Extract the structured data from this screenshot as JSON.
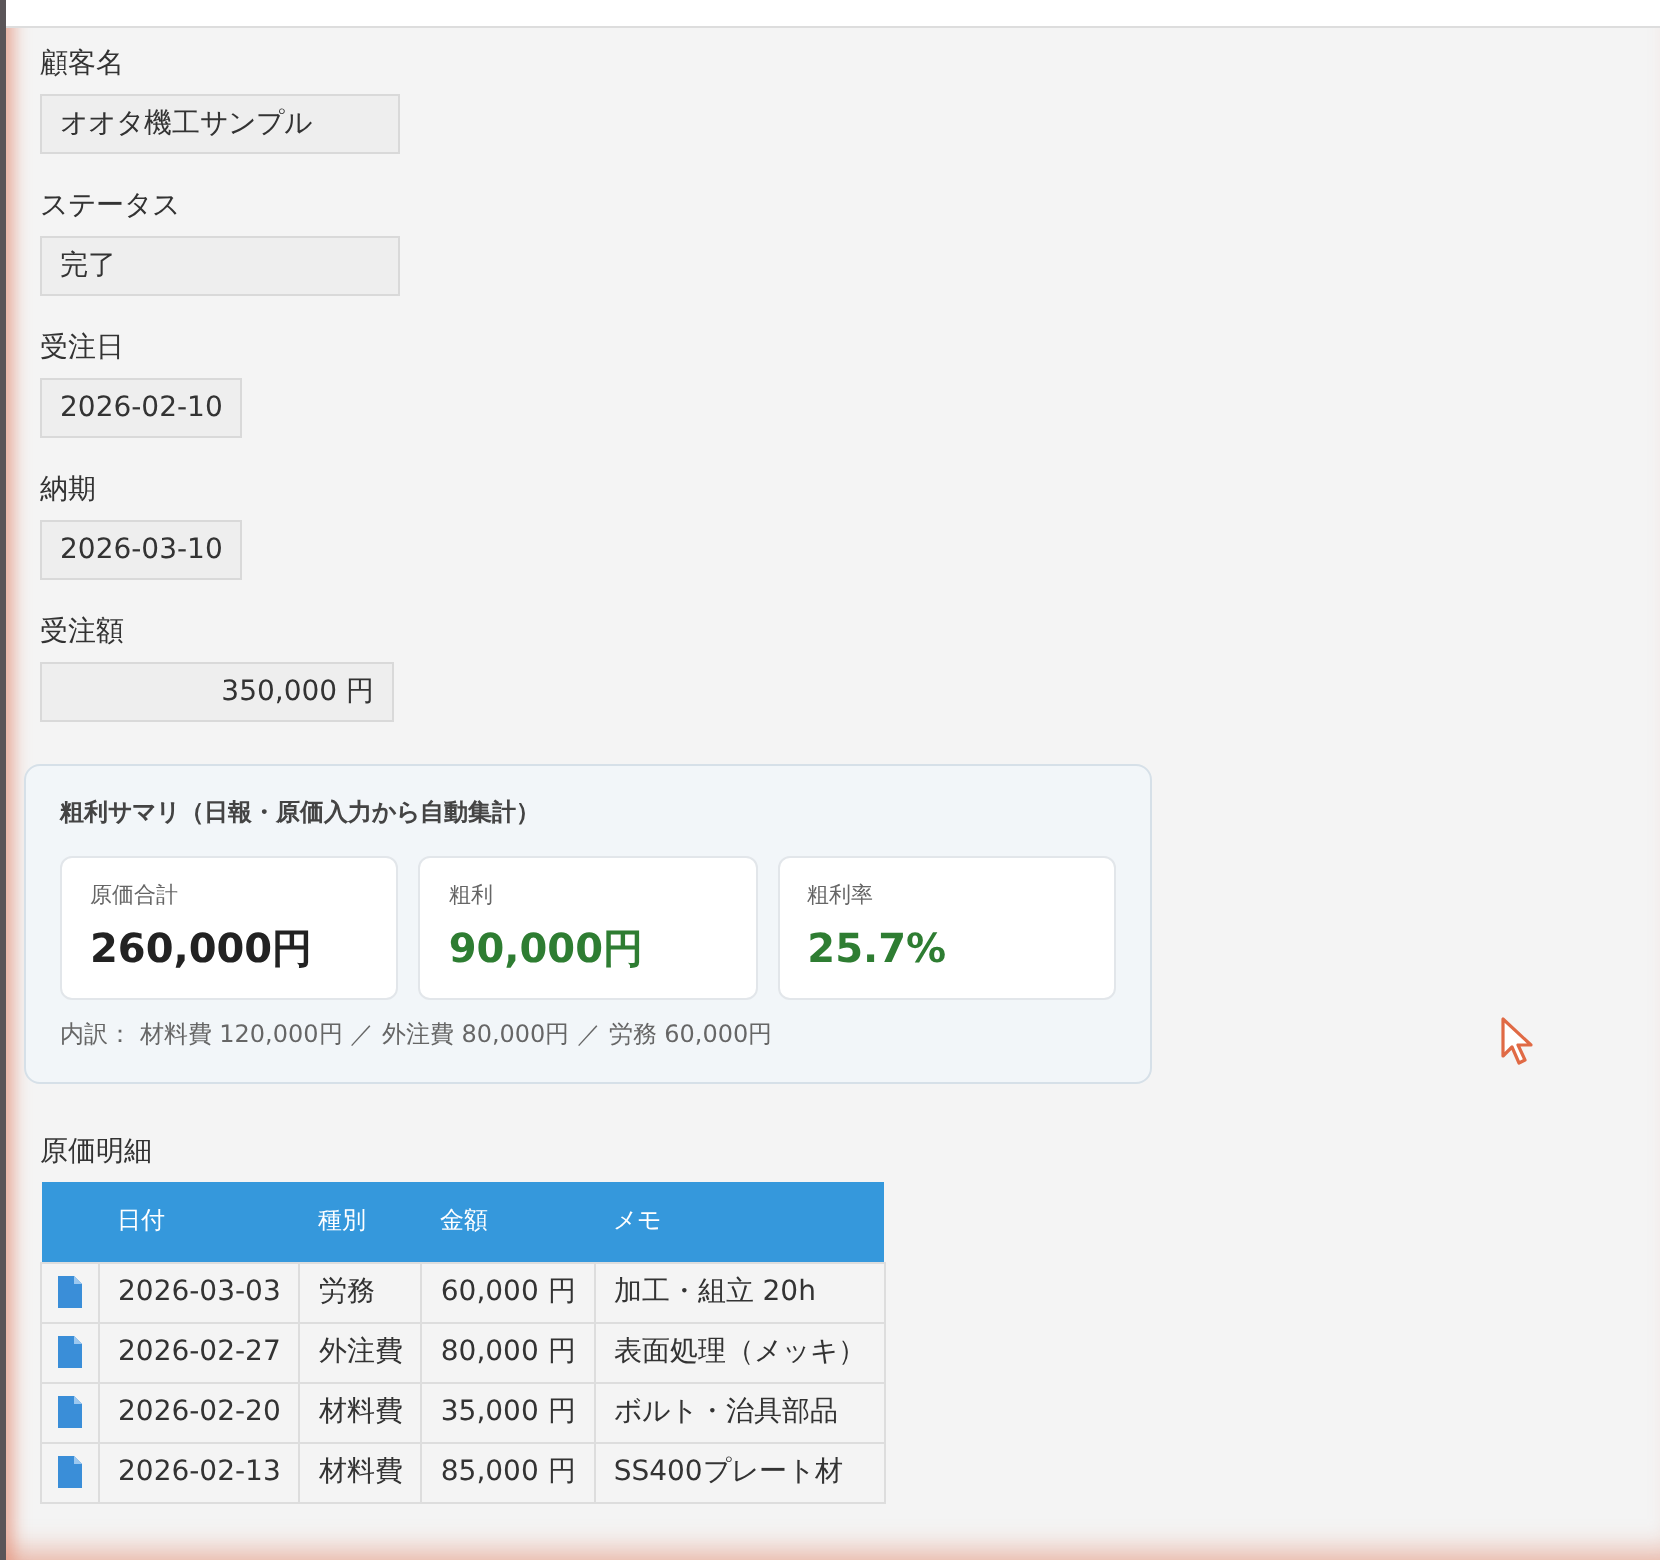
{
  "fields": [
    {
      "kind": "text",
      "label": "顧客名",
      "value": "オオタ機工サンプル"
    },
    {
      "kind": "text",
      "label": "ステータス",
      "value": "完了"
    },
    {
      "kind": "date",
      "label": "受注日",
      "value": "2026-02-10"
    },
    {
      "kind": "date",
      "label": "納期",
      "value": "2026-03-10"
    },
    {
      "kind": "amount",
      "label": "受注額",
      "value": "350,000 円"
    }
  ],
  "summary": {
    "title": "粗利サマリ（日報・原価入力から自動集計）",
    "cards": [
      {
        "label": "原価合計",
        "value": "260,000円",
        "color": "#222222"
      },
      {
        "label": "粗利",
        "value": "90,000円",
        "color": "#2e7d32"
      },
      {
        "label": "粗利率",
        "value": "25.7%",
        "color": "#2e7d32"
      }
    ],
    "breakdown": "内訳： 材料費 120,000円 ／ 外注費 80,000円 ／ 労務 60,000円"
  },
  "cost_details": {
    "title": "原価明細",
    "columns": [
      "日付",
      "種別",
      "金額",
      "メモ"
    ],
    "rows": [
      {
        "date": "2026-03-03",
        "type": "労務",
        "amount": "60,000 円",
        "memo": "加工・組立 20h"
      },
      {
        "date": "2026-02-27",
        "type": "外注費",
        "amount": "80,000 円",
        "memo": "表面処理（メッキ）"
      },
      {
        "date": "2026-02-20",
        "type": "材料費",
        "amount": "35,000 円",
        "memo": "ボルト・治具部品"
      },
      {
        "date": "2026-02-13",
        "type": "材料費",
        "amount": "85,000 円",
        "memo": "SS400プレート材"
      }
    ]
  }
}
